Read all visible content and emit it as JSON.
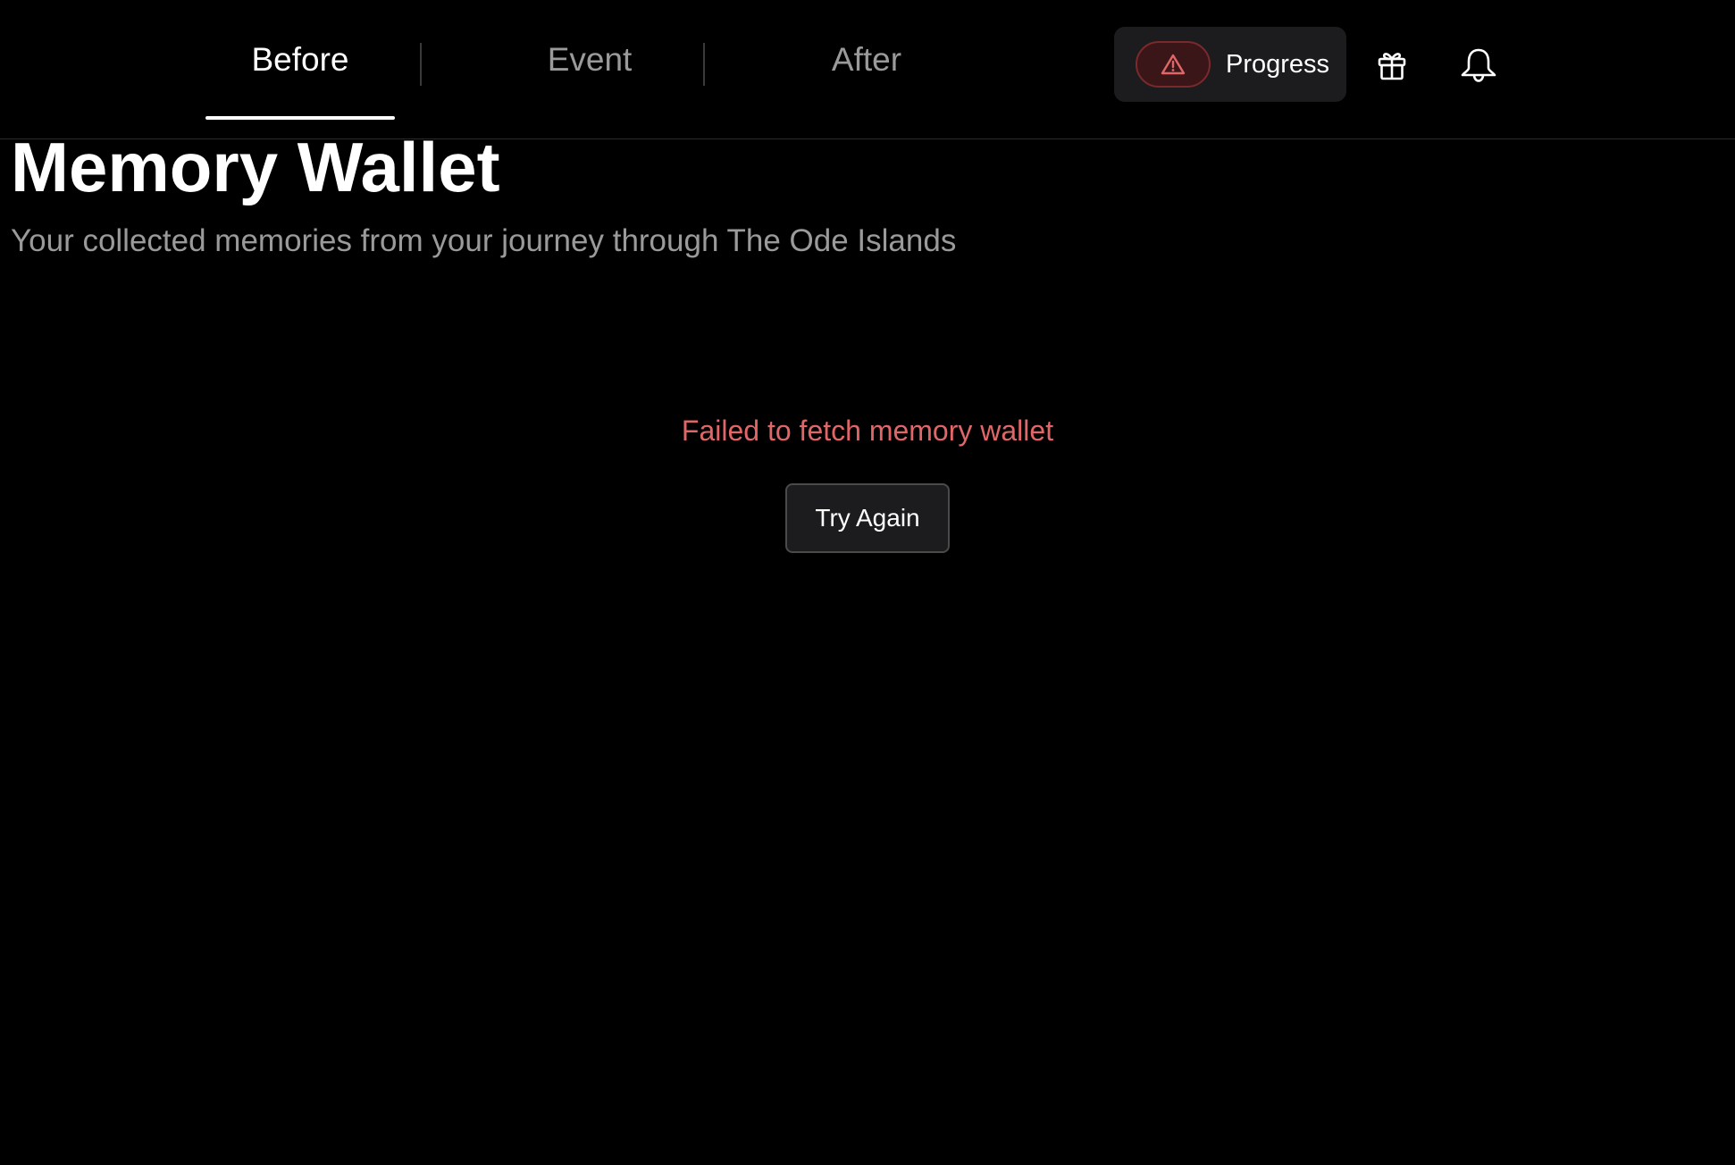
{
  "nav": {
    "tabs": [
      {
        "label": "Before",
        "active": true
      },
      {
        "label": "Event",
        "active": false
      },
      {
        "label": "After",
        "active": false
      }
    ],
    "progress_label": "Progress",
    "icons": {
      "warning": "warning-triangle-icon",
      "gift": "gift-icon",
      "bell": "bell-icon"
    }
  },
  "main": {
    "title": "Memory Wallet",
    "subtitle": "Your collected memories from your journey through The Ode Islands",
    "error_message": "Failed to fetch memory wallet",
    "retry_label": "Try Again"
  },
  "colors": {
    "background": "#000000",
    "error": "#e06668",
    "muted_text": "#9a9a9a"
  }
}
